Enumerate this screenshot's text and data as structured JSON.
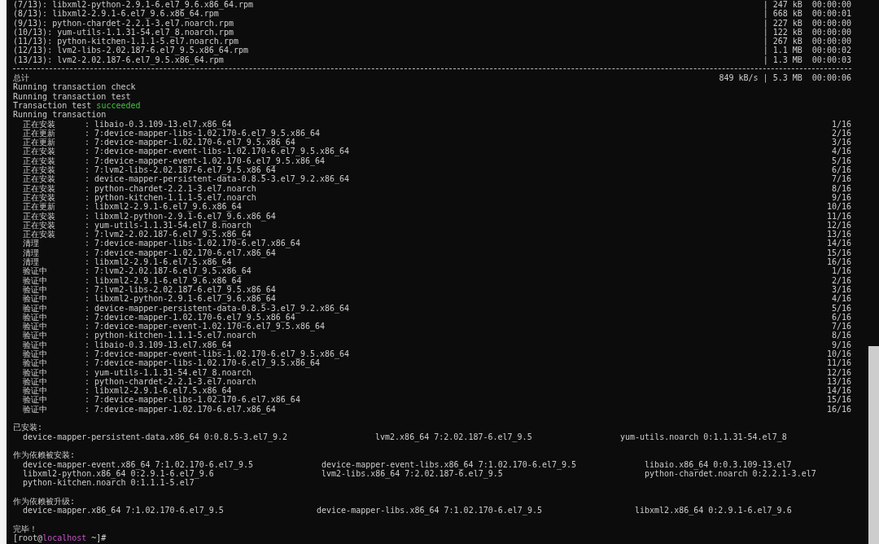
{
  "downloads": [
    {
      "text": "(7/13): libxml2-python-2.9.1-6.el7_9.6.x86_64.rpm",
      "meta": "| 247 kB  00:00:00"
    },
    {
      "text": "(8/13): libxml2-2.9.1-6.el7_9.6.x86_64.rpm",
      "meta": "| 668 kB  00:00:01"
    },
    {
      "text": "(9/13): python-chardet-2.2.1-3.el7.noarch.rpm",
      "meta": "| 227 kB  00:00:00"
    },
    {
      "text": "(10/13): yum-utils-1.1.31-54.el7_8.noarch.rpm",
      "meta": "| 122 kB  00:00:00"
    },
    {
      "text": "(11/13): python-kitchen-1.1.1-5.el7.noarch.rpm",
      "meta": "| 267 kB  00:00:00"
    },
    {
      "text": "(12/13): lvm2-libs-2.02.187-6.el7_9.5.x86_64.rpm",
      "meta": "| 1.1 MB  00:00:02"
    },
    {
      "text": "(13/13): lvm2-2.02.187-6.el7_9.5.x86_64.rpm",
      "meta": "| 1.3 MB  00:00:03"
    }
  ],
  "total": {
    "label": "总计",
    "meta": "849 kB/s | 5.3 MB  00:00:06"
  },
  "log_lines": [
    {
      "text": "Running transaction check"
    },
    {
      "text": "Running transaction test"
    },
    {
      "text": "Transaction test",
      "status": "succeeded"
    },
    {
      "text": "Running transaction"
    }
  ],
  "transaction": [
    {
      "action": "正在安装",
      "detail": ": libaio-0.3.109-13.el7.x86_64",
      "progress": "1/16"
    },
    {
      "action": "正在更新",
      "detail": ": 7:device-mapper-libs-1.02.170-6.el7_9.5.x86_64",
      "progress": "2/16"
    },
    {
      "action": "正在更新",
      "detail": ": 7:device-mapper-1.02.170-6.el7_9.5.x86_64",
      "progress": "3/16"
    },
    {
      "action": "正在安装",
      "detail": ": 7:device-mapper-event-libs-1.02.170-6.el7_9.5.x86_64",
      "progress": "4/16"
    },
    {
      "action": "正在安装",
      "detail": ": 7:device-mapper-event-1.02.170-6.el7_9.5.x86_64",
      "progress": "5/16"
    },
    {
      "action": "正在安装",
      "detail": ": 7:lvm2-libs-2.02.187-6.el7_9.5.x86_64",
      "progress": "6/16"
    },
    {
      "action": "正在安装",
      "detail": ": device-mapper-persistent-data-0.8.5-3.el7_9.2.x86_64",
      "progress": "7/16"
    },
    {
      "action": "正在安装",
      "detail": ": python-chardet-2.2.1-3.el7.noarch",
      "progress": "8/16"
    },
    {
      "action": "正在安装",
      "detail": ": python-kitchen-1.1.1-5.el7.noarch",
      "progress": "9/16"
    },
    {
      "action": "正在更新",
      "detail": ": libxml2-2.9.1-6.el7_9.6.x86_64",
      "progress": "10/16"
    },
    {
      "action": "正在安装",
      "detail": ": libxml2-python-2.9.1-6.el7_9.6.x86_64",
      "progress": "11/16"
    },
    {
      "action": "正在安装",
      "detail": ": yum-utils-1.1.31-54.el7_8.noarch",
      "progress": "12/16"
    },
    {
      "action": "正在安装",
      "detail": ": 7:lvm2-2.02.187-6.el7_9.5.x86_64",
      "progress": "13/16"
    },
    {
      "action": "清理",
      "detail": ": 7:device-mapper-libs-1.02.170-6.el7.x86_64",
      "progress": "14/16"
    },
    {
      "action": "清理",
      "detail": ": 7:device-mapper-1.02.170-6.el7.x86_64",
      "progress": "15/16"
    },
    {
      "action": "清理",
      "detail": ": libxml2-2.9.1-6.el7.5.x86_64",
      "progress": "16/16"
    },
    {
      "action": "验证中",
      "detail": ": 7:lvm2-2.02.187-6.el7_9.5.x86_64",
      "progress": "1/16"
    },
    {
      "action": "验证中",
      "detail": ": libxml2-2.9.1-6.el7_9.6.x86_64",
      "progress": "2/16"
    },
    {
      "action": "验证中",
      "detail": ": 7:lvm2-libs-2.02.187-6.el7_9.5.x86_64",
      "progress": "3/16"
    },
    {
      "action": "验证中",
      "detail": ": libxml2-python-2.9.1-6.el7_9.6.x86_64",
      "progress": "4/16"
    },
    {
      "action": "验证中",
      "detail": ": device-mapper-persistent-data-0.8.5-3.el7_9.2.x86_64",
      "progress": "5/16"
    },
    {
      "action": "验证中",
      "detail": ": 7:device-mapper-1.02.170-6.el7_9.5.x86_64",
      "progress": "6/16"
    },
    {
      "action": "验证中",
      "detail": ": 7:device-mapper-event-1.02.170-6.el7_9.5.x86_64",
      "progress": "7/16"
    },
    {
      "action": "验证中",
      "detail": ": python-kitchen-1.1.1-5.el7.noarch",
      "progress": "8/16"
    },
    {
      "action": "验证中",
      "detail": ": libaio-0.3.109-13.el7.x86_64",
      "progress": "9/16"
    },
    {
      "action": "验证中",
      "detail": ": 7:device-mapper-event-libs-1.02.170-6.el7_9.5.x86_64",
      "progress": "10/16"
    },
    {
      "action": "验证中",
      "detail": ": 7:device-mapper-libs-1.02.170-6.el7_9.5.x86_64",
      "progress": "11/16"
    },
    {
      "action": "验证中",
      "detail": ": yum-utils-1.1.31-54.el7_8.noarch",
      "progress": "12/16"
    },
    {
      "action": "验证中",
      "detail": ": python-chardet-2.2.1-3.el7.noarch",
      "progress": "13/16"
    },
    {
      "action": "验证中",
      "detail": ": libxml2-2.9.1-6.el7.5.x86_64",
      "progress": "14/16"
    },
    {
      "action": "验证中",
      "detail": ": 7:device-mapper-libs-1.02.170-6.el7.x86_64",
      "progress": "15/16"
    },
    {
      "action": "验证中",
      "detail": ": 7:device-mapper-1.02.170-6.el7.x86_64",
      "progress": "16/16"
    }
  ],
  "summary": [
    {
      "heading": "已安装:",
      "packages": [
        "device-mapper-persistent-data.x86_64 0:0.8.5-3.el7_9.2",
        "lvm2.x86_64 7:2.02.187-6.el7_9.5",
        "yum-utils.noarch 0:1.1.31-54.el7_8"
      ]
    },
    {
      "heading": "作为依赖被安装:",
      "packages": [
        "device-mapper-event.x86_64 7:1.02.170-6.el7_9.5",
        "device-mapper-event-libs.x86_64 7:1.02.170-6.el7_9.5",
        "libaio.x86_64 0:0.3.109-13.el7",
        "libxml2-python.x86_64 0:2.9.1-6.el7_9.6",
        "lvm2-libs.x86_64 7:2.02.187-6.el7_9.5",
        "python-chardet.noarch 0:2.2.1-3.el7",
        "python-kitchen.noarch 0:1.1.1-5.el7"
      ]
    },
    {
      "heading": "作为依赖被升级:",
      "packages": [
        "device-mapper.x86_64 7:1.02.170-6.el7_9.5",
        "device-mapper-libs.x86_64 7:1.02.170-6.el7_9.5",
        "libxml2.x86_64 0:2.9.1-6.el7_9.6"
      ]
    }
  ],
  "done": "完毕！",
  "prompt": {
    "before": "[root@",
    "host": "localhost",
    "after": " ~]#"
  }
}
